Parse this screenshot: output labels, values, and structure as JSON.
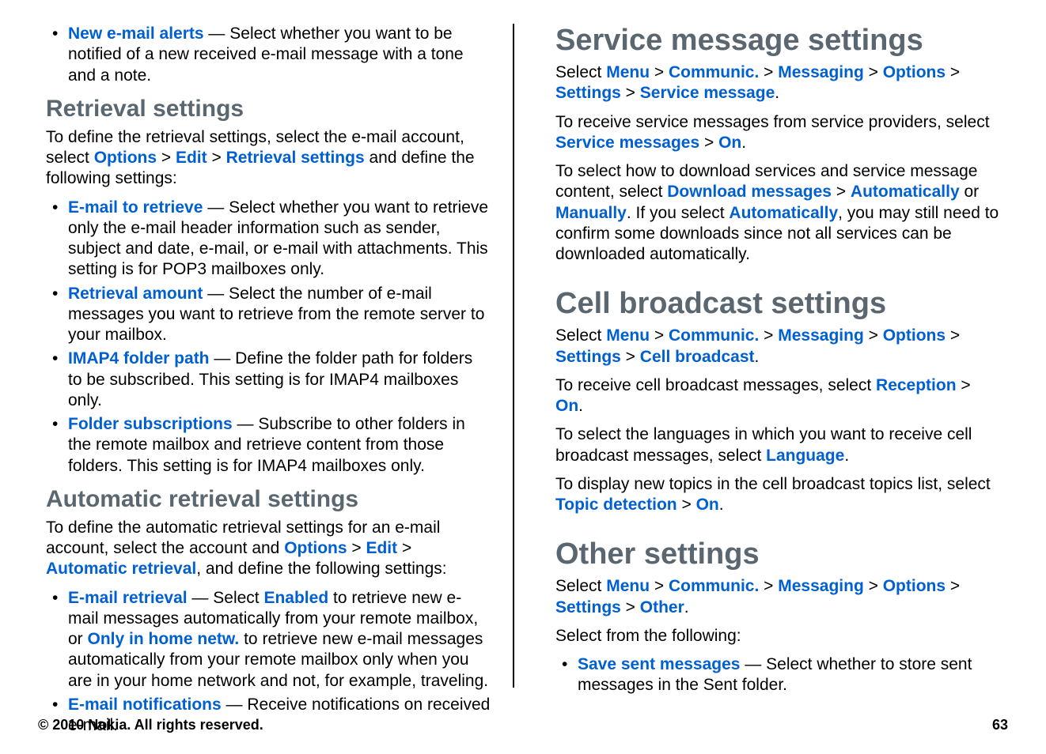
{
  "left": {
    "alerts": {
      "term": "New e-mail alerts",
      "desc": " — Select whether you want to be notified of a new received e-mail message with a tone and a note."
    },
    "retrieval": {
      "heading": "Retrieval settings",
      "intro_a": "To define the retrieval settings, select the e-mail account, select ",
      "options": "Options",
      "edit": "Edit",
      "rs": "Retrieval settings",
      "intro_b": " and define the following settings:",
      "items": [
        {
          "term": "E-mail to retrieve",
          "desc": " — Select whether you want to retrieve only the e-mail header information such as sender, subject and date, e-mail, or e-mail with attachments. This setting is for POP3 mailboxes only."
        },
        {
          "term": "Retrieval amount",
          "desc": " — Select the number of e-mail messages you want to retrieve from the remote server to your mailbox."
        },
        {
          "term": "IMAP4 folder path",
          "desc": " — Define the folder path for folders to be subscribed. This setting is for IMAP4 mailboxes only."
        },
        {
          "term": "Folder subscriptions",
          "desc": " — Subscribe to other folders in the remote mailbox and retrieve content from those folders. This setting is for IMAP4 mailboxes only."
        }
      ]
    },
    "auto": {
      "heading": "Automatic retrieval settings",
      "intro_a": "To define the automatic retrieval settings for an e-mail account, select the account and ",
      "options": "Options",
      "edit": "Edit",
      "ar": "Automatic retrieval",
      "intro_b": ", and define the following settings:",
      "items": [
        {
          "term": "E-mail retrieval",
          "desc_a": " — Select ",
          "enabled": "Enabled",
          "desc_b": " to retrieve new e-mail messages automatically from your remote mailbox, or ",
          "only": "Only in home netw.",
          "desc_c": " to retrieve new e-mail messages automatically from your remote mailbox only when you are in your home network and not, for example, traveling."
        },
        {
          "term": "E-mail notifications",
          "desc": " — Receive notifications on received e-mail."
        }
      ]
    }
  },
  "right": {
    "service": {
      "heading": "Service message settings",
      "path": {
        "pre": "Select ",
        "menu": "Menu",
        "communic": "Communic.",
        "messaging": "Messaging",
        "options": "Options",
        "settings": "Settings",
        "last": "Service message"
      },
      "p2_a": "To receive service messages from service providers, select ",
      "p2_sm": "Service messages",
      "p2_on": "On",
      "p3_a": "To select how to download services and service message content, select ",
      "p3_dm": "Download messages",
      "p3_auto": "Automatically",
      "p3_or": " or ",
      "p3_man": "Manually",
      "p3_b": ". If you select ",
      "p3_auto2": "Automatically",
      "p3_c": ", you may still need to confirm some downloads since not all services can be downloaded automatically."
    },
    "cell": {
      "heading": "Cell broadcast settings",
      "path": {
        "pre": "Select ",
        "menu": "Menu",
        "communic": "Communic.",
        "messaging": "Messaging",
        "options": "Options",
        "settings": "Settings",
        "last": "Cell broadcast"
      },
      "p2_a": "To receive cell broadcast messages, select ",
      "p2_rec": "Reception",
      "p2_on": "On",
      "p3_a": "To select the languages in which you want to receive cell broadcast messages, select ",
      "p3_lang": "Language",
      "p4_a": "To display new topics in the cell broadcast topics list, select ",
      "p4_td": "Topic detection",
      "p4_on": "On"
    },
    "other": {
      "heading": "Other settings",
      "path": {
        "pre": "Select ",
        "menu": "Menu",
        "communic": "Communic.",
        "messaging": "Messaging",
        "options": "Options",
        "settings": "Settings",
        "last": "Other"
      },
      "p2": "Select from the following:",
      "item": {
        "term": "Save sent messages",
        "desc": " — Select whether to store sent messages in the Sent folder."
      }
    }
  },
  "footer": {
    "copyright": "© 2010 Nokia. All rights reserved.",
    "page": "63"
  },
  "gt": " > "
}
